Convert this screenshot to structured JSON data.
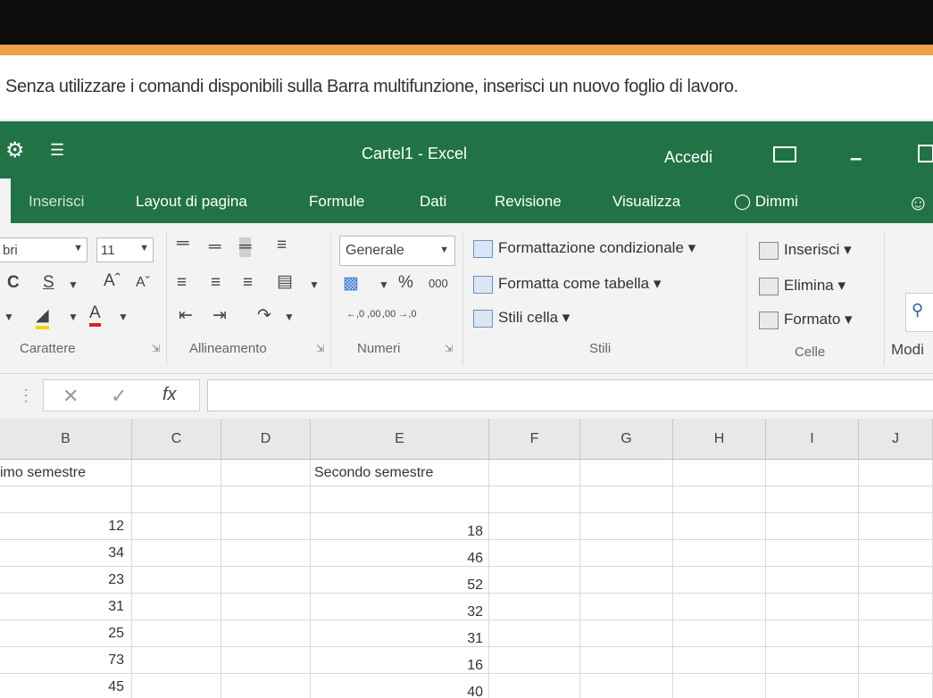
{
  "instruction": "Senza utilizzare i comandi disponibili sulla Barra multifunzione, inserisci un nuovo foglio di lavoro.",
  "titlebar": {
    "title": "Cartel1 - Excel",
    "signin": "Accedi",
    "app_icon": "save-icon",
    "qa_icon": "customize-quick-access-icon"
  },
  "tabs": [
    "Inserisci",
    "Layout di pagina",
    "Formule",
    "Dati",
    "Revisione",
    "Visualizza"
  ],
  "tell_me": "Dimmi",
  "ribbon": {
    "font_name": "bri",
    "font_size": "11",
    "number_format": "Generale",
    "number_icons": {
      "percent": "%",
      "thousands": "000",
      "inc_decimal": "←,0 ,00",
      "dec_decimal": ",00 →,0"
    },
    "styles": {
      "conditional": "Formattazione condizionale ▾",
      "as_table": "Formatta come tabella ▾",
      "cell_styles": "Stili cella ▾"
    },
    "cells": {
      "insert": "Inserisci ▾",
      "delete": "Elimina ▾",
      "format": "Formato ▾"
    },
    "groups": {
      "font": "Carattere",
      "alignment": "Allineamento",
      "number": "Numeri",
      "styles": "Stili",
      "cells": "Celle",
      "editing": "Modi"
    }
  },
  "formula_bar": {
    "fx": "fx"
  },
  "columns": [
    "B",
    "C",
    "D",
    "E",
    "F",
    "G",
    "H",
    "I",
    "J"
  ],
  "rows": [
    {
      "b": "imo semestre",
      "e": "Secondo semestre"
    },
    {
      "b": "",
      "e": ""
    },
    {
      "b": "12",
      "e": "18"
    },
    {
      "b": "34",
      "e": "46"
    },
    {
      "b": "23",
      "e": "52"
    },
    {
      "b": "31",
      "e": "32"
    },
    {
      "b": "25",
      "e": "31"
    },
    {
      "b": "73",
      "e": "16"
    },
    {
      "b": "45",
      "e": "40"
    }
  ],
  "colors": {
    "excel_green": "#217346",
    "ribbon_bg": "#f3f3f3",
    "accent_strip": "#f0a04a"
  }
}
